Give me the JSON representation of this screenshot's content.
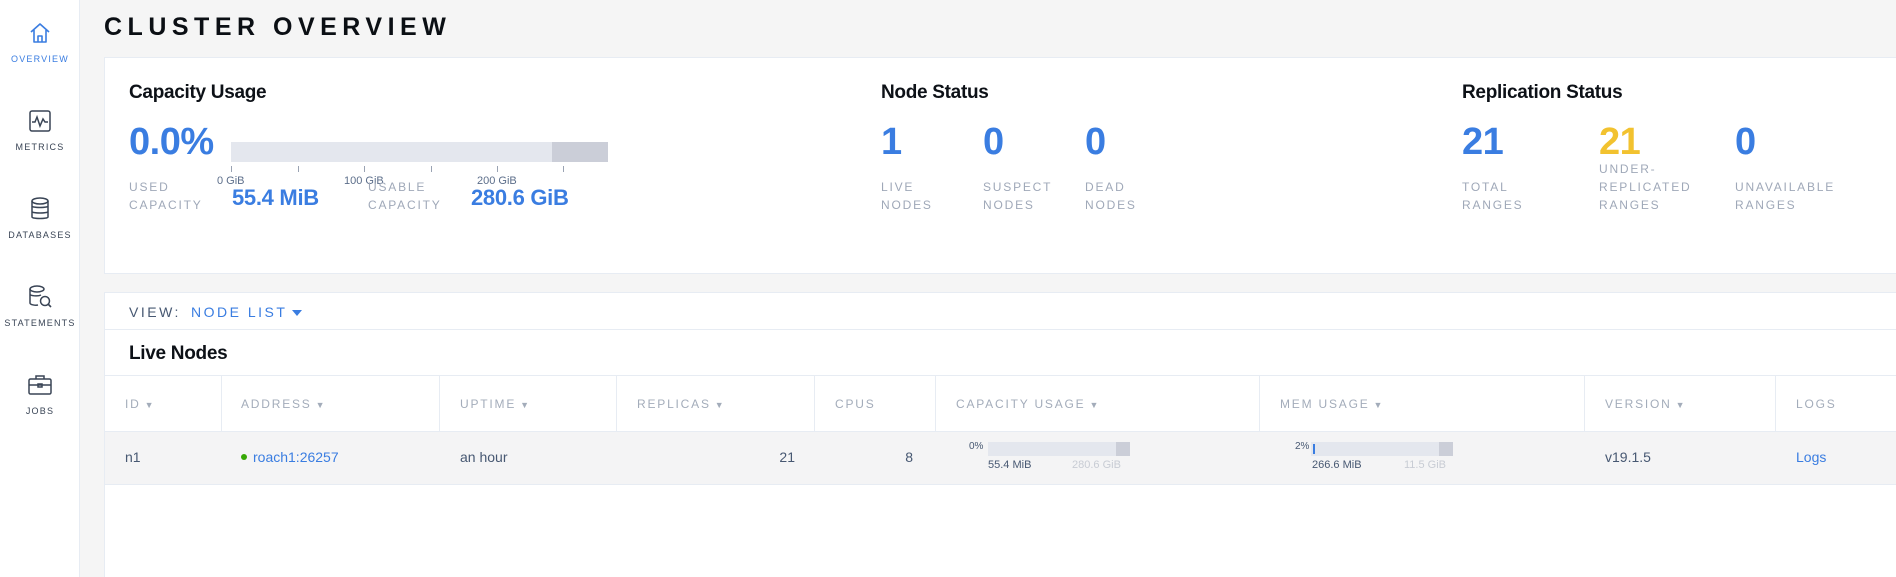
{
  "sidebar": {
    "items": [
      {
        "label": "OVERVIEW",
        "icon": "home-icon"
      },
      {
        "label": "METRICS",
        "icon": "metrics-icon"
      },
      {
        "label": "DATABASES",
        "icon": "database-icon"
      },
      {
        "label": "STATEMENTS",
        "icon": "statements-icon"
      },
      {
        "label": "JOBS",
        "icon": "briefcase-icon"
      }
    ]
  },
  "page": {
    "title": "CLUSTER OVERVIEW"
  },
  "capacity": {
    "title": "Capacity Usage",
    "percent": "0.0%",
    "ticks": [
      "0 GiB",
      "100 GiB",
      "200 GiB"
    ],
    "used_label_1": "USED",
    "used_label_2": "CAPACITY",
    "used_value": "55.4 MiB",
    "usable_label_1": "USABLE",
    "usable_label_2": "CAPACITY",
    "usable_value": "280.6 GiB"
  },
  "node_status": {
    "title": "Node Status",
    "live": "1",
    "live_l1": "LIVE",
    "live_l2": "NODES",
    "suspect": "0",
    "suspect_l1": "SUSPECT",
    "suspect_l2": "NODES",
    "dead": "0",
    "dead_l1": "DEAD",
    "dead_l2": "NODES"
  },
  "replication": {
    "title": "Replication Status",
    "total": "21",
    "total_l1": "TOTAL",
    "total_l2": "RANGES",
    "under": "21",
    "under_l1": "UNDER-",
    "under_l2": "REPLICATED",
    "under_l3": "RANGES",
    "unavailable": "0",
    "unavail_l1": "UNAVAILABLE",
    "unavail_l2": "RANGES"
  },
  "view": {
    "label": "VIEW:",
    "selected": "NODE LIST"
  },
  "live_nodes": {
    "title": "Live Nodes",
    "columns": [
      "ID",
      "ADDRESS",
      "UPTIME",
      "REPLICAS",
      "CPUS",
      "CAPACITY USAGE",
      "MEM USAGE",
      "VERSION",
      "LOGS"
    ],
    "rows": [
      {
        "id": "n1",
        "address": "roach1:26257",
        "uptime": "an hour",
        "replicas": "21",
        "cpus": "8",
        "cap_pct": "0%",
        "cap_used": "55.4 MiB",
        "cap_total": "280.6 GiB",
        "mem_pct": "2%",
        "mem_used": "266.6 MiB",
        "mem_total": "11.5 GiB",
        "version": "v19.1.5",
        "logs": "Logs"
      }
    ]
  },
  "colors": {
    "accent": "#3a7de1",
    "warning": "#f2c22f",
    "live_dot": "#37a806"
  }
}
